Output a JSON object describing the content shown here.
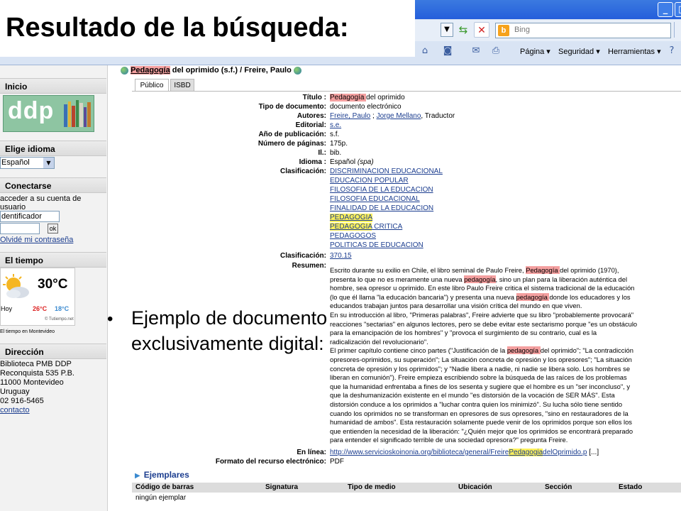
{
  "slide": {
    "title": "Resultado de la búsqueda:",
    "bullet": "Ejemplo de documento exclusivamente digital:"
  },
  "browser": {
    "search_placeholder": "Bing",
    "commands": {
      "page": "Página ▾",
      "security": "Seguridad ▾",
      "tools": "Herramientas ▾"
    }
  },
  "sidebar": {
    "inicio": "Inicio",
    "logo_text": "ddp",
    "elige_idioma": "Elige idioma",
    "language_selected": "Español",
    "conectarse": "Conectarse",
    "login_line1": "acceder a su cuenta de",
    "login_line2": "usuario",
    "login_input_value": "dentificador",
    "ok_label": "ok",
    "forgot_link": "Olvidé mi contraseña",
    "tiempo_head": "El tiempo",
    "weather": {
      "temp": "30°C",
      "day": "Hoy",
      "high": "26°C",
      "low": "18°C",
      "source": "© Tutiempo.net",
      "caption": "El tiempo en Montevideo"
    },
    "direccion_head": "Dirección",
    "address": [
      "Biblioteca PMB DDP",
      "Reconquista 535 P.B.",
      "11000 Montevideo",
      "Uruguay",
      "02 916-5465"
    ],
    "contacto": "contacto"
  },
  "record": {
    "title_hl": "Pedagogía",
    "title_rest": " del oprimido (s.f.) / Freire, Paulo",
    "tabs": [
      "Público",
      "ISBD"
    ],
    "fields": {
      "titulo_label": "Título :",
      "titulo_hl": "Pedagogía ",
      "titulo_rest": "del oprimido",
      "tipo_label": "Tipo de documento:",
      "tipo_value": "documento electrónico",
      "autores_label": "Autores:",
      "autor1": "Freire, Paulo",
      "autor_sep": " ; ",
      "autor2": "Jorge Mellano",
      "autor_role": ", Traductor",
      "editorial_label": "Editorial:",
      "editorial_value": "s.e.",
      "anio_label": "Año de publicación:",
      "anio_value": "s.f.",
      "paginas_label": "Número de páginas:",
      "paginas_value": "175p.",
      "il_label": "Il.:",
      "il_value": "bib.",
      "idioma_label": "Idioma :",
      "idioma_value": "Español",
      "idioma_code": " (spa)",
      "clasif_label": "Clasificación:",
      "clasif_items": [
        "DISCRIMINACION EDUCACIONAL",
        "EDUCACION POPULAR",
        "FILOSOFIA DE LA EDUCACION",
        "FILOSOFIA EDUCACIONAL",
        "FINALIDAD DE LA EDUCACION",
        "PEDAGOGIA",
        "PEDAGOGIA",
        "PEDAGOGOS",
        "POLITICAS DE EDUCACION"
      ],
      "clasif_critica": " CRITICA",
      "clasif2_label": "Clasificación:",
      "clasif2_value": "370.15",
      "resumen_label": "Resumen:",
      "resumen_lines": [
        [
          "Escrito durante su exilio en Chile, el libro seminal de Paulo Freire, ",
          "Pedagogía ",
          "del oprimido (1970),"
        ],
        [
          "presenta lo que no es meramente una nueva ",
          "pedagogía",
          ", sino un plan para la liberación auténtica del"
        ],
        [
          "hombre, sea opresor u oprimido. En este libro Paulo Freire critica el sistema tradicional de la educación",
          "",
          ""
        ],
        [
          "(lo que él llama \"la educación bancaria\") y presenta una nueva ",
          "pedagogía ",
          "donde los educadores y los"
        ],
        [
          "educandos trabajan juntos para desarrollar una visión crítica del mundo en que viven.",
          "",
          ""
        ],
        [
          "En su introducción al libro, \"Primeras palabras\", Freire advierte que su libro \"probablemente provocará\"",
          "",
          ""
        ],
        [
          "reacciones \"sectarias\" en algunos lectores, pero se debe evitar este sectarismo porque \"es un obstáculo",
          "",
          ""
        ],
        [
          "para la emancipación de los hombres\" y \"provoca el surgimiento de su contrario, cual es la",
          "",
          ""
        ],
        [
          "radicalización del revolucionario\".",
          "",
          ""
        ],
        [
          "El primer capítulo contiene cinco partes (\"Justificación de la ",
          "pedagogía ",
          "del oprimido\"; \"La contradicción"
        ],
        [
          "opresores-oprimidos, su superación\"; La situación concreta de opresión y los opresores\"; \"La situación",
          "",
          ""
        ],
        [
          "concreta de opresión y los oprimidos\"; y \"Nadie libera a nadie, ni nadie se libera solo. Los hombres se",
          "",
          ""
        ],
        [
          "liberan en comunión\"). Freire empieza escribiendo sobre la búsqueda de las raíces de los problemas",
          "",
          ""
        ],
        [
          "que la humanidad enfrentaba a fines de los sesenta y sugiere que el hombre es un \"ser inconcluso\", y",
          "",
          ""
        ],
        [
          "que la deshumanización existente en el mundo \"es distorsión de la vocación de SER MÁS\". Esta",
          "",
          ""
        ],
        [
          "distorsión conduce a los oprimidos a \"luchar contra quien los minimizó\". Su lucha sólo tiene sentido",
          "",
          ""
        ],
        [
          "cuando los oprimidos no se transforman en opresores de sus opresores, \"sino en restauradores de la",
          "",
          ""
        ],
        [
          "humanidad de ambos\". Esta restauración solamente puede venir de los oprimidos porque son ellos los",
          "",
          ""
        ],
        [
          "que entienden la necesidad de la liberación: \"¿Quién mejor que los oprimidos se encontrará preparado",
          "",
          ""
        ],
        [
          "para entender el significado terrible de una sociedad opresora?\" pregunta Freire.",
          "",
          ""
        ]
      ],
      "enlinea_label": "En línea:",
      "url_pre": "http://www.servicioskoinonia.org/biblioteca/general/Freire",
      "url_hl": "Pedagogia",
      "url_post": "delOprimido.p",
      "url_more": " [...]",
      "formato_label": "Formato del recurso electrónico:",
      "formato_value": "PDF"
    }
  },
  "ejemplares": {
    "head": "Ejemplares",
    "columns": [
      "Código de barras",
      "Signatura",
      "Tipo de medio",
      "Ubicación",
      "Sección",
      "Estado"
    ],
    "empty": "ningún ejemplar"
  }
}
